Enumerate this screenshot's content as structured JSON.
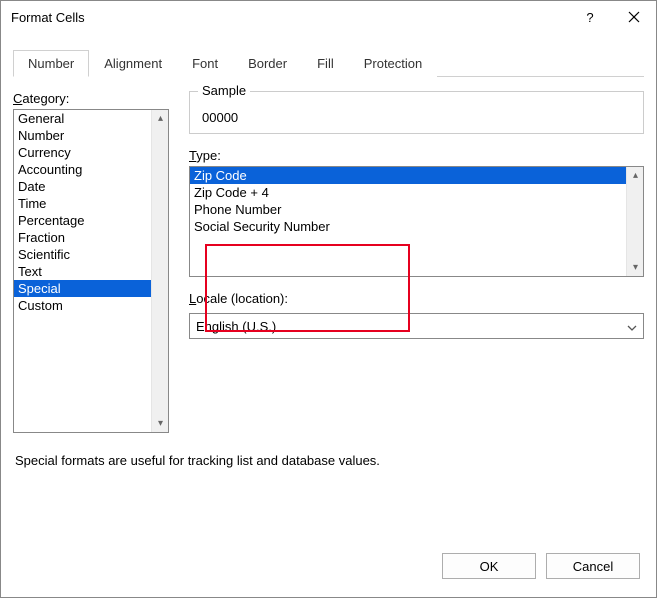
{
  "window": {
    "title": "Format Cells",
    "help_label": "?",
    "close_label": "✕"
  },
  "tabs": [
    {
      "label": "Number"
    },
    {
      "label": "Alignment"
    },
    {
      "label": "Font"
    },
    {
      "label": "Border"
    },
    {
      "label": "Fill"
    },
    {
      "label": "Protection"
    }
  ],
  "category": {
    "label_pre": "C",
    "label_post": "ategory:",
    "items": [
      "General",
      "Number",
      "Currency",
      "Accounting",
      "Date",
      "Time",
      "Percentage",
      "Fraction",
      "Scientific",
      "Text",
      "Special",
      "Custom"
    ],
    "selected": "Special"
  },
  "sample": {
    "label": "Sample",
    "value": "00000"
  },
  "type": {
    "label_pre": "T",
    "label_post": "ype:",
    "items": [
      "Zip Code",
      "Zip Code + 4",
      "Phone Number",
      "Social Security Number"
    ],
    "selected": "Zip Code"
  },
  "locale": {
    "label_pre": "L",
    "label_post": "ocale (location):",
    "value": "English (U.S.)"
  },
  "description": "Special formats are useful for tracking list and database values.",
  "buttons": {
    "ok": "OK",
    "cancel": "Cancel"
  }
}
